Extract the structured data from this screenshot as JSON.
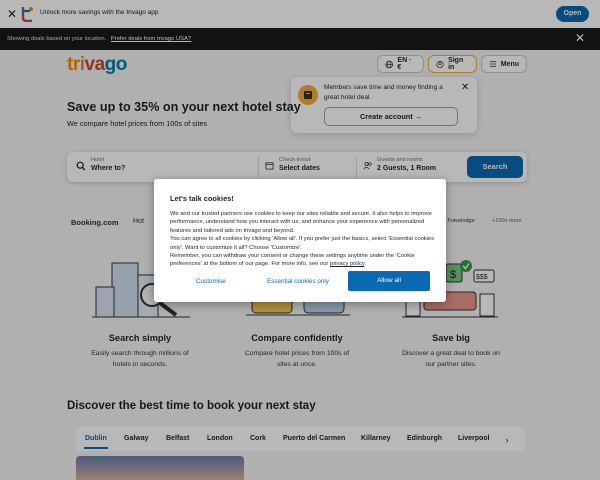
{
  "app_banner": {
    "text": "Unlock more savings with the trivago app",
    "open_label": "Open"
  },
  "location_bar": {
    "text": "Showing deals based on your location.",
    "link": "Prefer deals from trivago USA?"
  },
  "header": {
    "logo": {
      "part1": "tri",
      "part2": "va",
      "part3": "go"
    },
    "language": "EN · €",
    "sign_in": "Sign in",
    "menu": "Menu"
  },
  "popover": {
    "text": "Members save time and money finding a great hotel deal.",
    "create_account": "Create account"
  },
  "hero": {
    "title": "Save up to 35% on your next hotel stay",
    "subtitle": "We compare hotel prices from 100s of sites"
  },
  "search": {
    "hotel_label": "Hotel",
    "hotel_value": "Where to?",
    "checkin_label": "Check-in/out",
    "checkin_value": "Select dates",
    "guests_label": "Guests and rooms",
    "guests_value": "2 Guests, 1 Room",
    "button": "Search"
  },
  "partners": {
    "items": [
      "Booking.com",
      "Hot",
      "Travelodge",
      "+100s more"
    ]
  },
  "features": [
    {
      "title": "Search simply",
      "desc_line1": "Easily search through millions of",
      "desc_line2": "hotels in seconds."
    },
    {
      "title": "Compare confidently",
      "desc_line1": "Compare hotel prices from 100s of",
      "desc_line2": "sites at once."
    },
    {
      "title": "Save big",
      "desc_line1": "Discover a great deal to book on",
      "desc_line2": "our partner sites."
    }
  ],
  "discover": {
    "title": "Discover the best time to book your next stay",
    "cities": [
      "Dublin",
      "Galway",
      "Belfast",
      "London",
      "Cork",
      "Puerto del Carmen",
      "Killarney",
      "Edinburgh",
      "Liverpool"
    ]
  },
  "cookie": {
    "title": "Let's talk cookies!",
    "body_1": "We and our trusted partners use cookies to keep our sites reliable and secure. It also helps to improve performance, understand how you interact with us, and enhance your experience with personalized features and tailored ads on trivago and beyond.",
    "body_2": "You can agree to all cookies by clicking 'Allow all'. If you prefer just the basics, select 'Essential cookies only'. Want to customize it all? Choose 'Customize'.",
    "body_3": "Remember, you can withdraw your consent or change these settings anytime under the 'Cookie preferences' at the bottom of our page. For more info, see our",
    "privacy_link": "privacy policy",
    "customise": "Customise",
    "essential": "Essential cookies only",
    "allow_all": "Allow all"
  },
  "colors": {
    "brand_blue": "#0a6ab1",
    "logo_orange": "#f48f00",
    "logo_red": "#c94a38",
    "logo_teal": "#007fad"
  }
}
